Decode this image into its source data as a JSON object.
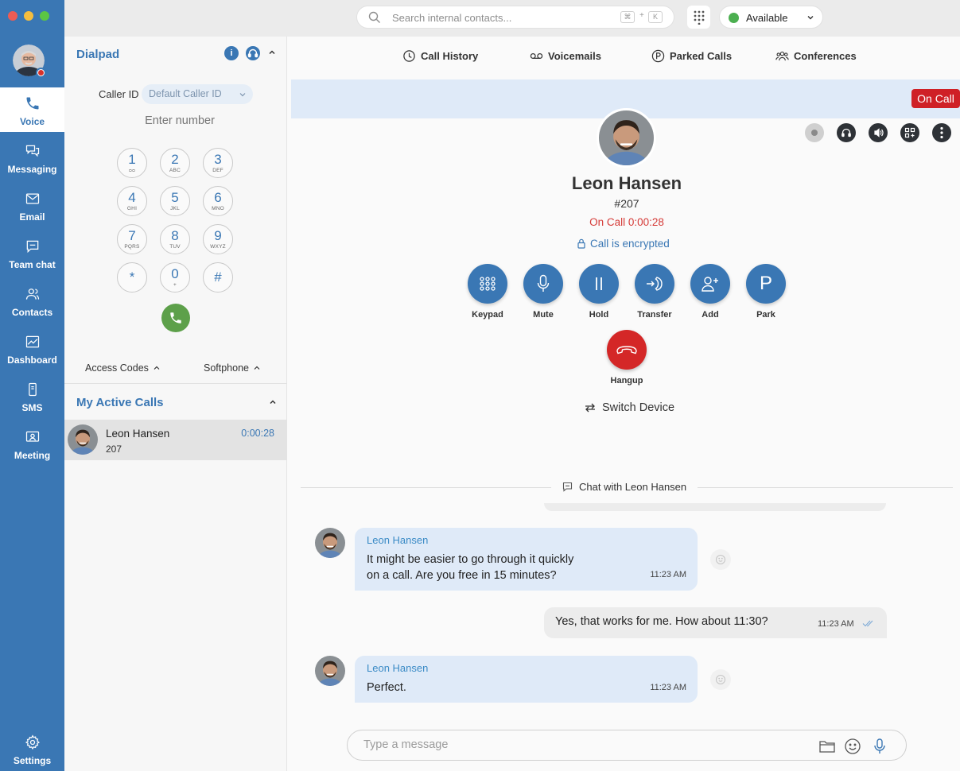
{
  "nav": {
    "items": [
      {
        "label": "Voice",
        "icon": "phone-icon"
      },
      {
        "label": "Messaging",
        "icon": "chat-bubbles-icon"
      },
      {
        "label": "Email",
        "icon": "envelope-icon"
      },
      {
        "label": "Team chat",
        "icon": "speech-bubble-icon"
      },
      {
        "label": "Contacts",
        "icon": "people-icon"
      },
      {
        "label": "Dashboard",
        "icon": "chart-icon"
      },
      {
        "label": "SMS",
        "icon": "mobile-icon"
      },
      {
        "label": "Meeting",
        "icon": "meeting-icon"
      }
    ],
    "settings": "Settings"
  },
  "topbar": {
    "search_placeholder": "Search internal contacts...",
    "shortcut_cmd": "⌘",
    "shortcut_plus": "+",
    "shortcut_key": "K",
    "status": "Available"
  },
  "dialpad": {
    "title": "Dialpad",
    "info_icon": "i",
    "caller_id_label": "Caller ID",
    "caller_id_value": "Default Caller ID",
    "number_placeholder": "Enter number",
    "keys": [
      {
        "d": "1",
        "l": "ᴑᴑ"
      },
      {
        "d": "2",
        "l": "ABC"
      },
      {
        "d": "3",
        "l": "DEF"
      },
      {
        "d": "4",
        "l": "GHI"
      },
      {
        "d": "5",
        "l": "JKL"
      },
      {
        "d": "6",
        "l": "MNO"
      },
      {
        "d": "7",
        "l": "PQRS"
      },
      {
        "d": "8",
        "l": "TUV"
      },
      {
        "d": "9",
        "l": "WXYZ"
      },
      {
        "d": "*",
        "l": ""
      },
      {
        "d": "0",
        "l": "+"
      },
      {
        "d": "#",
        "l": ""
      }
    ],
    "access_codes": "Access Codes",
    "softphone": "Softphone"
  },
  "active_calls": {
    "title": "My Active Calls",
    "items": [
      {
        "name": "Leon Hansen",
        "ext": "207",
        "duration": "0:00:28"
      }
    ]
  },
  "tabs": {
    "call_history": "Call History",
    "voicemails": "Voicemails",
    "parked_calls": "Parked Calls",
    "conferences": "Conferences"
  },
  "call": {
    "badge": "On Call",
    "name": "Leon Hansen",
    "ext": "#207",
    "status": "On Call 0:00:28",
    "encrypted": "Call is encrypted",
    "actions": {
      "keypad": "Keypad",
      "mute": "Mute",
      "hold": "Hold",
      "transfer": "Transfer",
      "add": "Add",
      "park": "Park",
      "park_glyph": "P",
      "hangup": "Hangup"
    },
    "switch_device": "Switch Device"
  },
  "chat": {
    "header": "Chat with Leon Hansen",
    "messages": [
      {
        "from": "Leon Hansen",
        "line1": "It might be easier to go through it quickly",
        "line2": "on a call. Are you free in 15 minutes?",
        "time": "11:23 AM"
      },
      {
        "from": "me",
        "text": "Yes, that works for me. How about 11:30?",
        "time": "11:23 AM"
      },
      {
        "from": "Leon Hansen",
        "text": "Perfect.",
        "time": "11:23 AM"
      }
    ],
    "composer_placeholder": "Type a message"
  },
  "colors": {
    "brand": "#3a77b4",
    "on_call_red": "#cf2026",
    "available_green": "#4caf50",
    "call_green": "#5da04a"
  }
}
